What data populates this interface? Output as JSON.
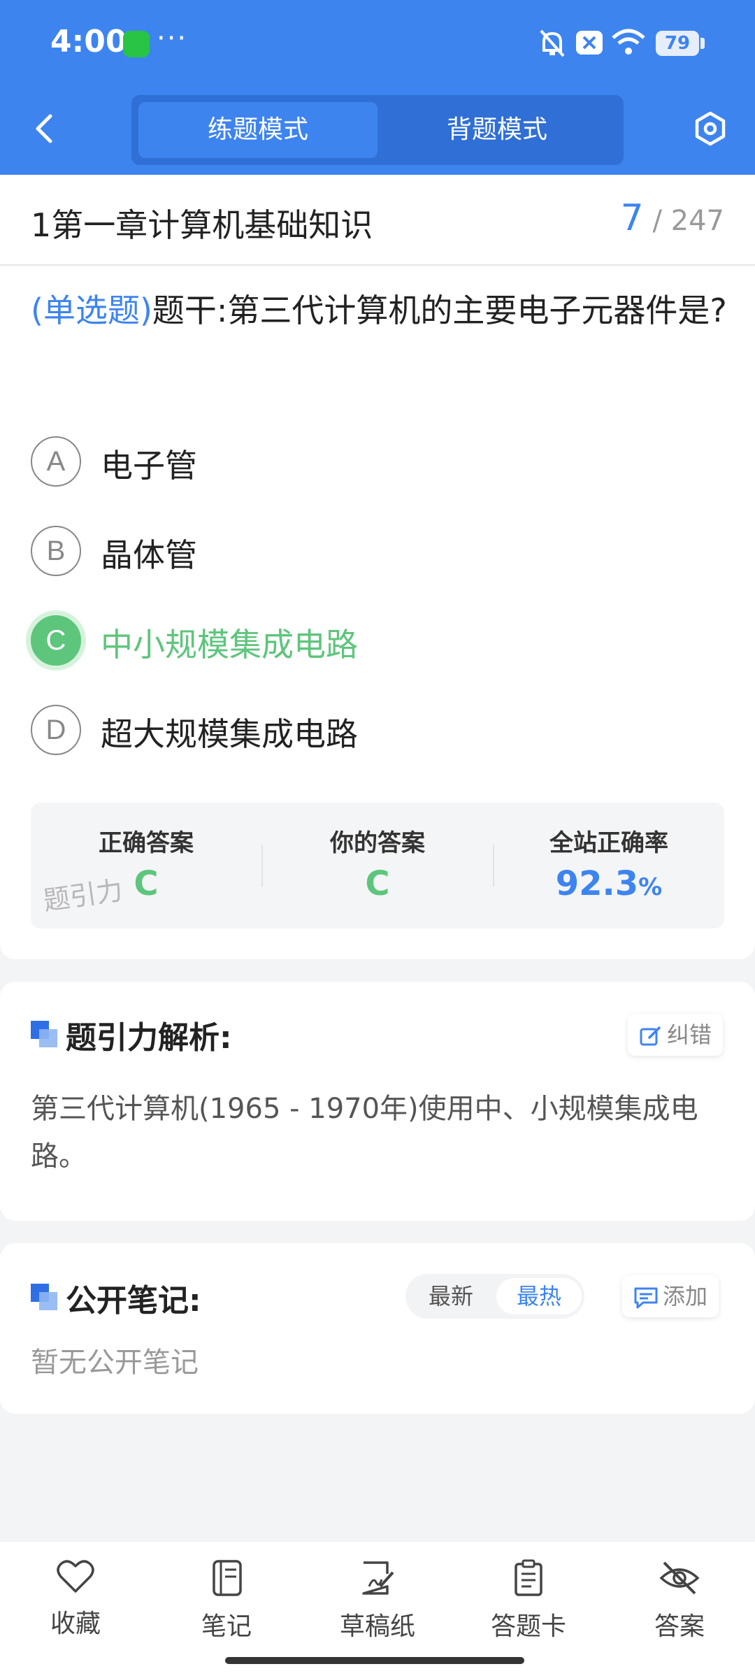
{
  "status_bar": {
    "time": "4:00",
    "more": "···",
    "battery": "79"
  },
  "header": {
    "modes": [
      "练题模式",
      "背题模式"
    ],
    "active_mode": "练题模式"
  },
  "chapter": {
    "title": "1第一章计算机基础知识",
    "current": "7",
    "total": "/ 247"
  },
  "question": {
    "type_label": "(单选题)",
    "stem": "题干:第三代计算机的主要电子元器件是?"
  },
  "options": [
    {
      "letter": "A",
      "text": "电子管"
    },
    {
      "letter": "B",
      "text": "晶体管"
    },
    {
      "letter": "C",
      "text": "中小规模集成电路",
      "state": "correct-selected"
    },
    {
      "letter": "D",
      "text": "超大规模集成电路"
    }
  ],
  "answer_summary": {
    "correct_label": "正确答案",
    "correct_value": "C",
    "yours_label": "你的答案",
    "yours_value": "C",
    "rate_label": "全站正确率",
    "rate_value": "92.3",
    "rate_unit": "%",
    "watermark": "题引力"
  },
  "analysis": {
    "title": "题引力解析:",
    "report_button": "纠错",
    "text": "第三代计算机(1965 - 1970年)使用中、小规模集成电路。"
  },
  "notes": {
    "title": "公开笔记:",
    "sort_options": [
      "最新",
      "最热"
    ],
    "active_sort": "最热",
    "add_button": "添加",
    "empty_text": "暂无公开笔记"
  },
  "bottom_nav": [
    {
      "label": "收藏",
      "icon": "heart-icon"
    },
    {
      "label": "笔记",
      "icon": "notebook-icon"
    },
    {
      "label": "草稿纸",
      "icon": "draft-paper-icon"
    },
    {
      "label": "答题卡",
      "icon": "answer-sheet-icon"
    },
    {
      "label": "答案",
      "icon": "eye-off-icon"
    }
  ],
  "colors": {
    "primary": "#3d84ef",
    "correct": "#5ec57c",
    "muted": "#999999"
  }
}
